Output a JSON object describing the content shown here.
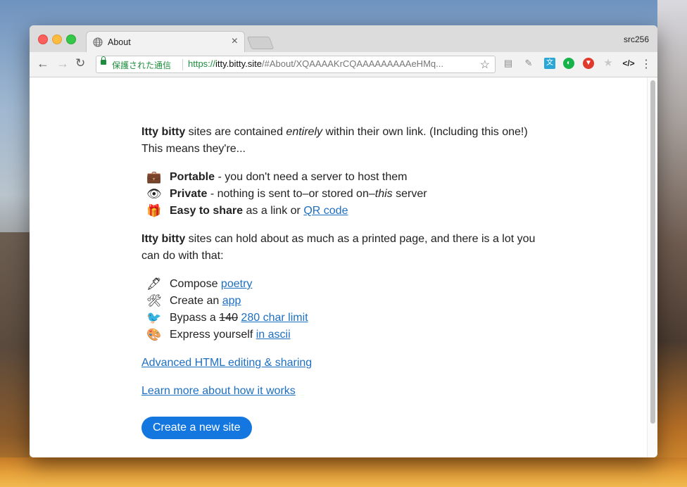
{
  "window": {
    "tab_title": "About",
    "profile_name": "src256",
    "colors": {
      "secure_green": "#1e8e3e",
      "link_blue": "#1d6fc1",
      "button_blue": "#1477e0"
    }
  },
  "toolbar": {
    "secure_label": "保護された通信",
    "url_scheme": "https://",
    "url_host": "itty.bitty.site",
    "url_rest": "/#About/XQAAAAKrCQAAAAAAAAAeHMq..."
  },
  "extensions": [
    "document-icon",
    "pin-icon",
    "translate-icon",
    "tracker-icon",
    "vivaldi-icon",
    "star-extension-icon",
    "code-icon"
  ],
  "page": {
    "intro_bold": "Itty bitty",
    "intro_rest1": " sites are contained ",
    "intro_em": "entirely",
    "intro_rest2": " within their own link. (Including this one!) This means they're...",
    "features": [
      {
        "icon": "💼",
        "bold": "Portable",
        "text": " - you don't need a server to host them"
      },
      {
        "icon": "👁",
        "bold": "Private",
        "text": " - nothing is sent to–or stored on–",
        "em": "this",
        "text2": " server"
      },
      {
        "icon": "🎁",
        "bold": "Easy to share",
        "text": " as a link or ",
        "link": "QR code"
      }
    ],
    "para2_bold": "Itty bitty",
    "para2_rest": " sites can hold about as much as a printed page, and there is a lot you can do with that:",
    "uses": [
      {
        "icon": "🖋",
        "text": "Compose ",
        "link": "poetry"
      },
      {
        "icon": "🛠",
        "text": "Create an ",
        "link": "app"
      },
      {
        "icon": "🐦",
        "text": "Bypass a ",
        "strike": "140",
        "link": "280 char limit"
      },
      {
        "icon": "🎨",
        "text": "Express yourself ",
        "link": "in ascii"
      }
    ],
    "advanced_link": "Advanced HTML editing & sharing",
    "learn_link": "Learn more about how it works",
    "create_button": "Create a new site"
  }
}
